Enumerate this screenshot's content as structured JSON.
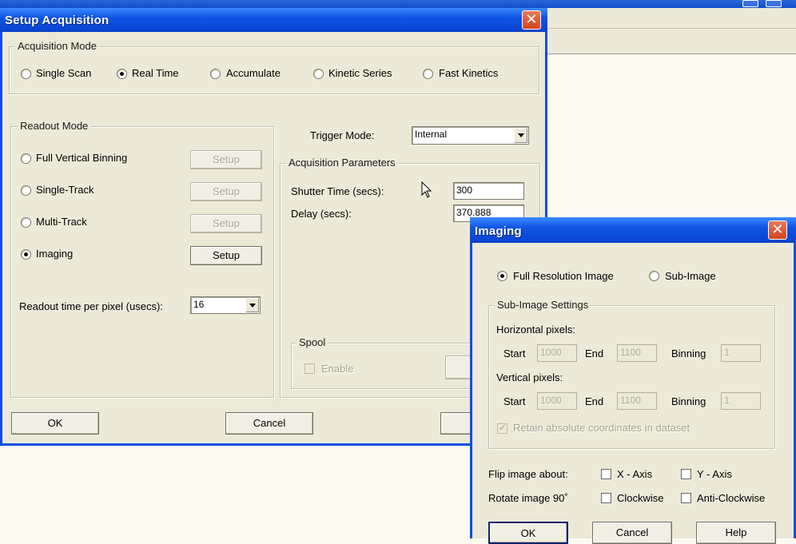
{
  "setup_dialog": {
    "title": "Setup Acquisition",
    "close_glyph": "✕",
    "acquisition_mode": {
      "legend": "Acquisition Mode",
      "options": [
        "Single Scan",
        "Real Time",
        "Accumulate",
        "Kinetic Series",
        "Fast Kinetics"
      ],
      "selected": "Real Time"
    },
    "readout_mode": {
      "legend": "Readout Mode",
      "options": [
        "Full Vertical Binning",
        "Single-Track",
        "Multi-Track",
        "Imaging"
      ],
      "selected": "Imaging",
      "setup_label": "Setup",
      "readout_time_label": "Readout time per pixel (usecs):",
      "readout_time_value": "16"
    },
    "trigger_mode": {
      "label": "Trigger Mode:",
      "value": "Internal"
    },
    "acquisition_parameters": {
      "legend": "Acquisition Parameters",
      "shutter_time_label": "Shutter Time (secs):",
      "shutter_time_value": "300",
      "delay_label": "Delay (secs):",
      "delay_value": "370.888"
    },
    "spool": {
      "legend": "Spool",
      "enable_label": "Enable",
      "setup_partial": "S"
    },
    "buttons": {
      "ok": "OK",
      "cancel": "Cancel"
    }
  },
  "imaging_dialog": {
    "title": "Imaging",
    "close_glyph": "✕",
    "resolution": {
      "options": [
        "Full Resolution Image",
        "Sub-Image"
      ],
      "selected": "Full Resolution Image"
    },
    "sub_image_settings": {
      "legend": "Sub-Image Settings",
      "horizontal_label": "Horizontal pixels:",
      "vertical_label": "Vertical pixels:",
      "start_label": "Start",
      "end_label": "End",
      "binning_label": "Binning",
      "horizontal": {
        "start": "1000",
        "end": "1100",
        "binning": "1"
      },
      "vertical": {
        "start": "1000",
        "end": "1100",
        "binning": "1"
      },
      "retain_label": "Retain absolute coordinates in dataset",
      "retain_checked": true
    },
    "flip": {
      "label": "Flip image about:",
      "x_axis": "X - Axis",
      "y_axis": "Y - Axis"
    },
    "rotate": {
      "label": "Rotate image 90˚",
      "clockwise": "Clockwise",
      "anticlockwise": "Anti-Clockwise"
    },
    "buttons": {
      "ok": "OK",
      "cancel": "Cancel",
      "help": "Help"
    }
  }
}
